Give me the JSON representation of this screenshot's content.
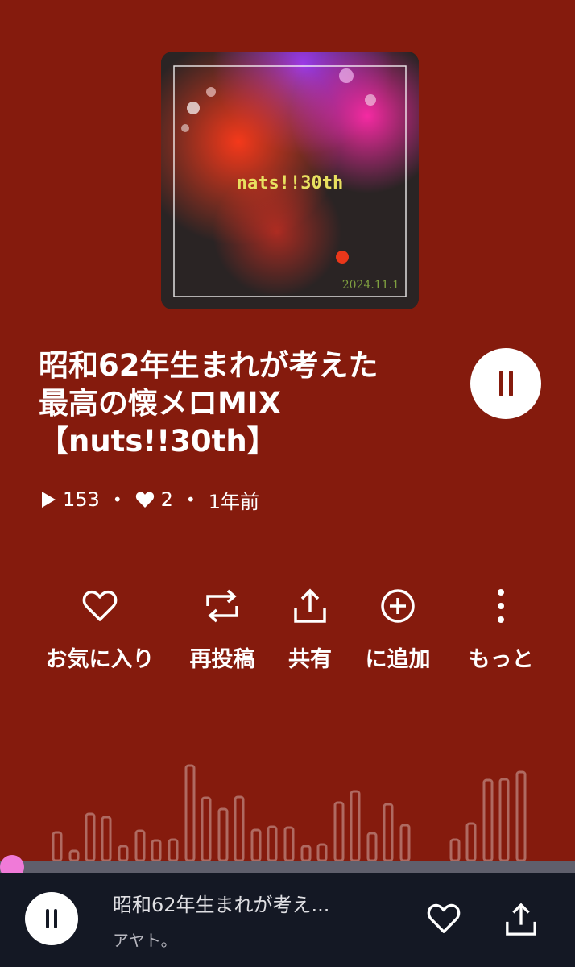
{
  "track": {
    "title": "昭和62年生まれが考えた\n最高の懐メロMIX\n【nuts!!30th】",
    "artwork_text": "nats!!30th",
    "artwork_date": "2024.11.1",
    "plays": "153",
    "likes": "2",
    "posted": "1年前"
  },
  "actions": [
    {
      "label": "お気に入り",
      "icon": "heart-outline-icon"
    },
    {
      "label": "再投稿",
      "icon": "repost-icon"
    },
    {
      "label": "共有",
      "icon": "share-icon"
    },
    {
      "label": "に追加",
      "icon": "add-circle-icon"
    },
    {
      "label": "もっと",
      "icon": "more-vertical-icon"
    }
  ],
  "player": {
    "progress": 0.0,
    "mini_title": "昭和62年生まれが考え...",
    "mini_artist": "アヤト。",
    "accent_color": "#f07ad8",
    "background_color": "#851b0d"
  }
}
